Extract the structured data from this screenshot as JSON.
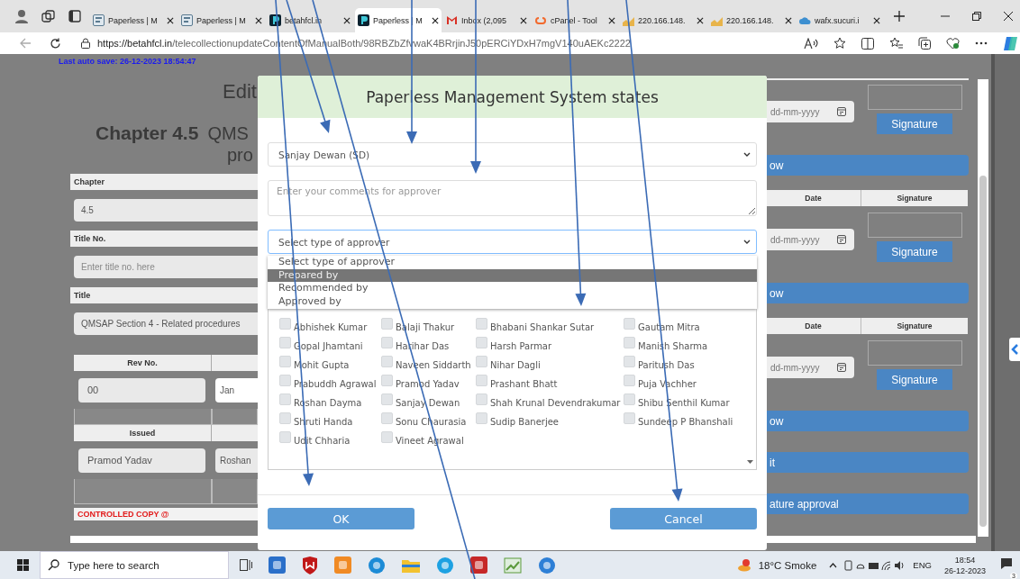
{
  "browser": {
    "tabs": [
      {
        "title": "Paperless | M",
        "selected": false
      },
      {
        "title": "Paperless | M",
        "selected": false
      },
      {
        "title": "betahfcl.in",
        "selected": false
      },
      {
        "title": "Paperless | M",
        "selected": true
      },
      {
        "title": "Inbox (2,095",
        "selected": false
      },
      {
        "title": "cPanel - Tool",
        "selected": false
      },
      {
        "title": "220.166.148.",
        "selected": false
      },
      {
        "title": "220.166.148.",
        "selected": false
      },
      {
        "title": "wafx.sucuri.i",
        "selected": false
      }
    ],
    "url_host": "https://betahfcl.in",
    "url_path": "/telecollectionupdateContentOfManualBoth/98RBZbZfvwaK4BRrjinJ50pERCiYDxH7mgV140uAEKc2222"
  },
  "page": {
    "autosave": "Last auto save: 26-12-2023 18:54:47",
    "heading": "Edit",
    "chapter": "Chapter 4.5",
    "title_part_1": "QMS",
    "title_part_2": "pro",
    "sections": [
      {
        "label": "Chapter",
        "value": "4.5"
      },
      {
        "label": "Title No.",
        "placeholder": "Enter title no. here"
      },
      {
        "label": "Title",
        "value": "QMSAP Section 4 - Related procedures"
      }
    ],
    "rev_header": "Rev No.",
    "rev_value": "00",
    "month_value": "Jan",
    "issued_header": "Issued",
    "issued_by": "Pramod Yadav",
    "column_2_value": "Roshan",
    "controlled_copy": "CONTROLLED COPY @",
    "right_items": [
      {
        "kind": "sign",
        "date_placeholder": "dd-mm-yyyy",
        "button": "Signature"
      },
      {
        "kind": "bar",
        "text": "ow"
      },
      {
        "kind": "headers",
        "columns": [
          "Date",
          "Signature"
        ]
      },
      {
        "kind": "sign",
        "date_placeholder": "dd-mm-yyyy",
        "button": "Signature"
      },
      {
        "kind": "bar",
        "text": "ow"
      },
      {
        "kind": "headers",
        "columns": [
          "Date",
          "Signature"
        ]
      },
      {
        "kind": "sign",
        "date_placeholder": "dd-mm-yyyy",
        "button": "Signature"
      },
      {
        "kind": "bar",
        "text": "ow"
      },
      {
        "kind": "bar",
        "text": "it"
      },
      {
        "kind": "bar",
        "text": "ature approval"
      }
    ]
  },
  "modal": {
    "title": "Paperless Management System states",
    "approver": "Sanjay Dewan (SD)",
    "comments_placeholder": "Enter your comments for approver",
    "type_select": "Select type of approver",
    "type_options": [
      {
        "label": "Select type of approver",
        "selected": false
      },
      {
        "label": "Prepared by",
        "selected": true
      },
      {
        "label": "Recommended by",
        "selected": false
      },
      {
        "label": "Approved by",
        "selected": false
      }
    ],
    "people": [
      {
        "name": "Abhishek Kumar",
        "checked": false
      },
      {
        "name": "Balaji Thakur",
        "checked": false
      },
      {
        "name": "Bhabani Shankar Sutar",
        "checked": false
      },
      {
        "name": "Gautam Mitra",
        "checked": false
      },
      {
        "name": "Gopal Jhamtani",
        "checked": false
      },
      {
        "name": "Harihar Das",
        "checked": false
      },
      {
        "name": "Harsh Parmar",
        "checked": false
      },
      {
        "name": "Manish Sharma",
        "checked": false
      },
      {
        "name": "Mohit Gupta",
        "checked": false
      },
      {
        "name": "Naveen Siddarth",
        "checked": false
      },
      {
        "name": "Nihar Dagli",
        "checked": false
      },
      {
        "name": "Paritush Das",
        "checked": false
      },
      {
        "name": "Prabuddh Agrawal",
        "checked": false
      },
      {
        "name": "Pramod Yadav",
        "checked": false
      },
      {
        "name": "Prashant Bhatt",
        "checked": false
      },
      {
        "name": "Puja Vachher",
        "checked": false
      },
      {
        "name": "Roshan Dayma",
        "checked": false
      },
      {
        "name": "Sanjay Dewan",
        "checked": false
      },
      {
        "name": "Shah Krunal Devendrakumar",
        "checked": false
      },
      {
        "name": "Shibu Senthil Kumar",
        "checked": false
      },
      {
        "name": "Shruti Handa",
        "checked": false
      },
      {
        "name": "Sonu Chaurasia",
        "checked": false
      },
      {
        "name": "Sudip Banerjee",
        "checked": false
      },
      {
        "name": "Sundeep P Bhanshali",
        "checked": false
      },
      {
        "name": "Udit Chharia",
        "checked": false
      },
      {
        "name": "Vineet Agrawal",
        "checked": false
      }
    ],
    "ok": "OK",
    "cancel": "Cancel"
  },
  "taskbar": {
    "search_placeholder": "Type here to search",
    "weather": "18°C Smoke",
    "language": "ENG",
    "time": "18:54",
    "date": "26-12-2023",
    "notifications": "3"
  }
}
